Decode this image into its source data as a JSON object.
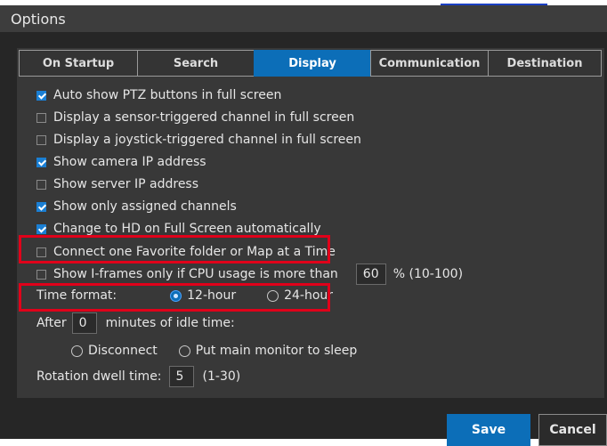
{
  "dialog": {
    "title": "Options"
  },
  "tabs": [
    {
      "label": "On Startup",
      "active": false
    },
    {
      "label": "Search",
      "active": false
    },
    {
      "label": "Display",
      "active": true
    },
    {
      "label": "Communication",
      "active": false
    },
    {
      "label": "Destination",
      "active": false
    }
  ],
  "options": [
    {
      "label": "Auto show PTZ buttons in full screen",
      "checked": true
    },
    {
      "label": "Display a sensor-triggered channel in full screen",
      "checked": false
    },
    {
      "label": "Display a joystick-triggered channel in full screen",
      "checked": false
    },
    {
      "label": "Show camera IP address",
      "checked": true
    },
    {
      "label": "Show server IP address",
      "checked": false
    },
    {
      "label": "Show only assigned channels",
      "checked": true
    },
    {
      "label": "Change to HD on Full Screen automatically",
      "checked": true
    },
    {
      "label": "Connect one Favorite folder or Map at a Time",
      "checked": false
    }
  ],
  "iframes": {
    "label": "Show I-frames only if CPU usage is more than",
    "checked": false,
    "value": "60",
    "range": "% (10-100)"
  },
  "time_format": {
    "label": "Time format:",
    "options": [
      "12-hour",
      "24-hour"
    ],
    "selected": "12-hour"
  },
  "idle": {
    "prefix": "After",
    "value": "0",
    "suffix": "minutes of idle time:",
    "options": [
      "Disconnect",
      "Put main monitor to sleep"
    ]
  },
  "rotation": {
    "label": "Rotation dwell time:",
    "value": "5",
    "range": "(1-30)"
  },
  "buttons": {
    "save": "Save",
    "cancel": "Cancel"
  },
  "colors": {
    "accent": "#0c6eb8",
    "highlight": "#e0001a",
    "background": "#262626"
  }
}
